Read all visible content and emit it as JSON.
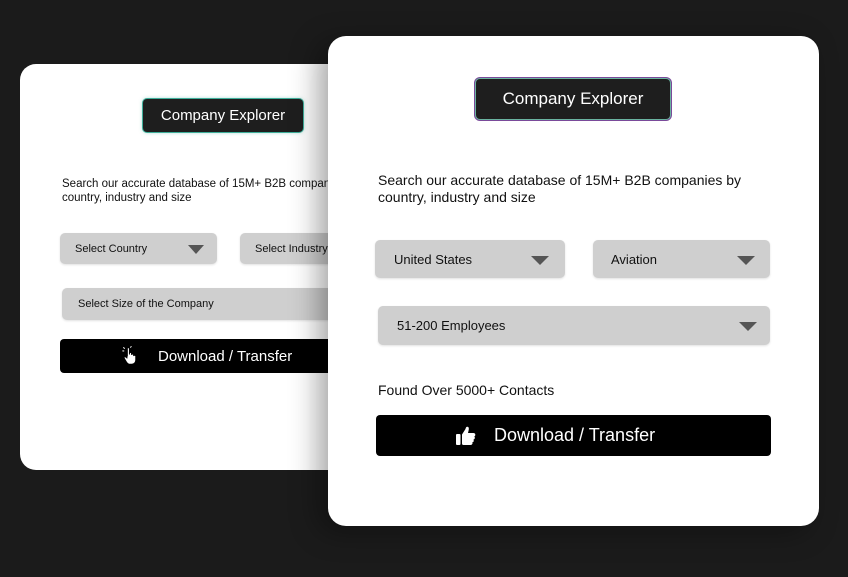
{
  "back_card": {
    "title": "Company Explorer",
    "description": "Search our accurate database of 15M+ B2B companies by country, industry and size",
    "country_select": "Select Country",
    "industry_select": "Select Industry",
    "size_select": "Select Size of the Company",
    "download_label": "Download / Transfer",
    "download_icon": "pointing-hand-icon"
  },
  "front_card": {
    "title": "Company Explorer",
    "description": "Search our accurate database of 15M+ B2B companies by country, industry and size",
    "country_select": "United States",
    "industry_select": "Aviation",
    "size_select": "51-200 Employees",
    "found_text": "Found Over 5000+ Contacts",
    "download_label": "Download / Transfer",
    "download_icon": "thumbs-up-icon"
  },
  "colors": {
    "background": "#1b1b1b",
    "card": "#ffffff",
    "badge": "#1e1e1e",
    "select": "#cfcfcf",
    "button": "#000000"
  }
}
